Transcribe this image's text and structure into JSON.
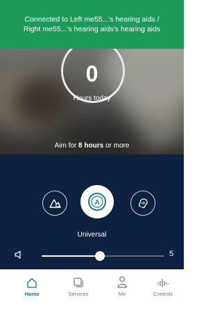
{
  "banner": {
    "line1": "Connected to Left me55...'s hearing aids /",
    "line2": "Right me55...'s hearing aids's hearing aids"
  },
  "hours": {
    "value": "0",
    "label": "Hours today",
    "aim_prefix": "Aim for",
    "aim_bold": "8 hours",
    "aim_suffix": "or more"
  },
  "program": {
    "name": "Universal",
    "buttons": [
      {
        "icon": "outdoor-program-icon"
      },
      {
        "icon": "universal-program-icon",
        "selected": true
      },
      {
        "icon": "speech-program-icon"
      }
    ]
  },
  "volume": {
    "icon": "speaker-icon",
    "value": "5",
    "level_fraction": 0.48
  },
  "tabs": [
    {
      "label": "Home",
      "icon": "home-icon",
      "active": true
    },
    {
      "label": "Services",
      "icon": "services-icon",
      "active": false
    },
    {
      "label": "Me",
      "icon": "person-icon",
      "active": false
    },
    {
      "label": "Controls",
      "icon": "equalizer-icon",
      "active": false
    }
  ],
  "colors": {
    "banner": "#1a9b57",
    "controls_bg": "#0d2140",
    "accent": "#1b66b1"
  }
}
